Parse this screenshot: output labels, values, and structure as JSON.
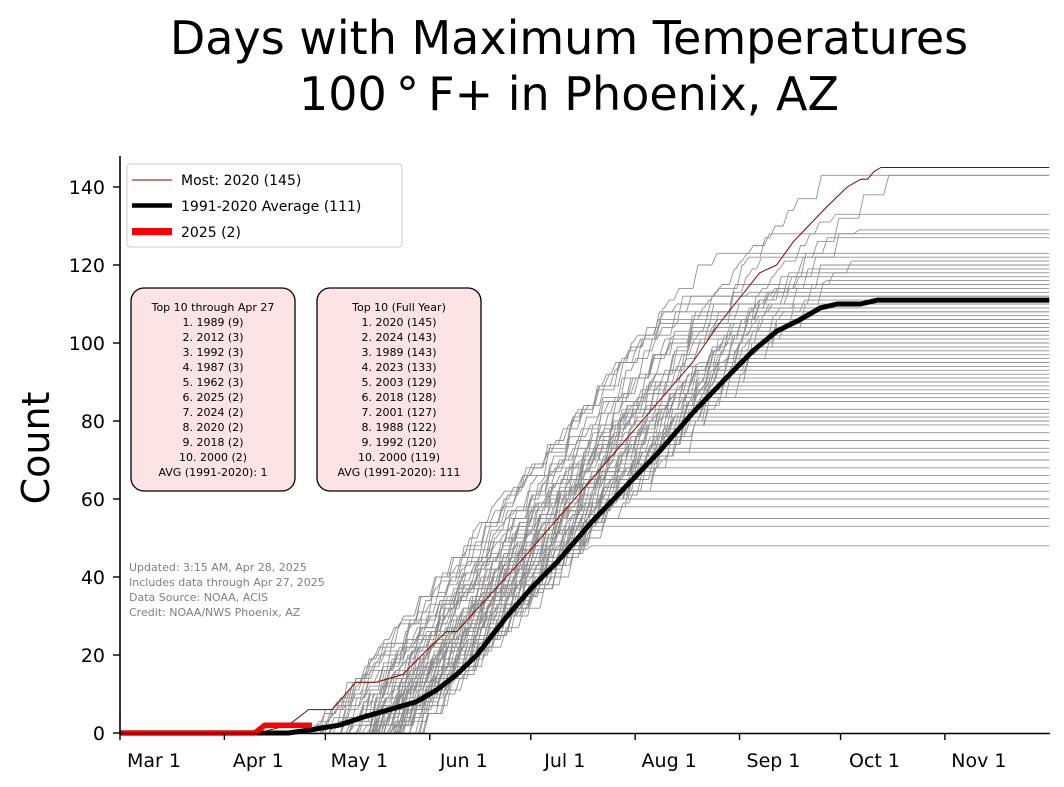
{
  "chart_data": {
    "type": "line",
    "title": [
      "Days with Maximum Temperatures",
      "100 ° F+ in Phoenix, AZ"
    ],
    "xlabel": "",
    "ylabel": "Count",
    "x_axis": {
      "unit": "days since Mar 1",
      "range": [
        0,
        276
      ],
      "ticks": [
        {
          "day": 0,
          "label": "Mar 1"
        },
        {
          "day": 31,
          "label": "Apr 1"
        },
        {
          "day": 61,
          "label": "May 1"
        },
        {
          "day": 92,
          "label": "Jun 1"
        },
        {
          "day": 122,
          "label": "Jul 1"
        },
        {
          "day": 153,
          "label": "Aug 1"
        },
        {
          "day": 184,
          "label": "Sep 1"
        },
        {
          "day": 214,
          "label": "Oct 1"
        },
        {
          "day": 245,
          "label": "Nov 1"
        }
      ]
    },
    "y_axis": {
      "range": [
        0,
        148
      ],
      "ticks": [
        0,
        20,
        40,
        60,
        80,
        100,
        120,
        140
      ]
    },
    "grid": false,
    "legend": {
      "placement": "top-left",
      "entries": [
        {
          "label": "Most: 2020 (145)",
          "color": "#8b0000",
          "style": "thin"
        },
        {
          "label": "1991-2020 Average (111)",
          "color": "#000000",
          "style": "thick"
        },
        {
          "label": "2025 (2)",
          "color": "#ff0000",
          "style": "thick"
        }
      ]
    },
    "highlight_series": {
      "most": {
        "name": "2020",
        "color": "#8b0000",
        "final": 145,
        "points": [
          [
            0,
            0
          ],
          [
            41,
            0
          ],
          [
            50,
            2
          ],
          [
            56,
            6
          ],
          [
            63,
            6
          ],
          [
            70,
            13
          ],
          [
            76,
            13
          ],
          [
            84,
            15
          ],
          [
            92,
            22
          ],
          [
            97,
            26
          ],
          [
            100,
            26
          ],
          [
            120,
            45
          ],
          [
            125,
            50
          ],
          [
            140,
            65
          ],
          [
            170,
            95
          ],
          [
            178,
            105
          ],
          [
            190,
            118
          ],
          [
            195,
            120
          ],
          [
            200,
            126
          ],
          [
            210,
            135
          ],
          [
            216,
            140
          ],
          [
            220,
            142
          ],
          [
            222,
            142
          ],
          [
            224,
            144
          ],
          [
            226,
            145
          ],
          [
            276,
            145
          ]
        ]
      },
      "average": {
        "name": "1991-2020 Average",
        "color": "#000000",
        "final": 111,
        "points": [
          [
            0,
            0
          ],
          [
            50,
            0
          ],
          [
            58,
            1
          ],
          [
            65,
            2
          ],
          [
            72,
            4
          ],
          [
            80,
            6
          ],
          [
            88,
            8
          ],
          [
            94,
            11
          ],
          [
            100,
            15
          ],
          [
            106,
            20
          ],
          [
            115,
            30
          ],
          [
            122,
            37
          ],
          [
            130,
            44
          ],
          [
            140,
            54
          ],
          [
            150,
            63
          ],
          [
            160,
            72
          ],
          [
            170,
            82
          ],
          [
            180,
            91
          ],
          [
            188,
            98
          ],
          [
            195,
            103
          ],
          [
            202,
            106
          ],
          [
            208,
            109
          ],
          [
            213,
            110
          ],
          [
            220,
            110
          ],
          [
            225,
            111
          ],
          [
            276,
            111
          ]
        ]
      },
      "current": {
        "name": "2025",
        "color": "#ff0000",
        "final": 2,
        "points": [
          [
            0,
            0
          ],
          [
            40,
            0
          ],
          [
            43,
            2
          ],
          [
            57,
            2
          ],
          [
            57,
            2
          ]
        ]
      }
    },
    "background_series_finals": [
      48,
      53,
      55,
      58,
      60,
      62,
      64,
      66,
      68,
      70,
      72,
      73,
      75,
      77,
      79,
      80,
      81,
      82,
      83,
      85,
      86,
      87,
      88,
      89,
      90,
      91,
      92,
      93,
      94,
      95,
      96,
      97,
      98,
      99,
      100,
      100,
      101,
      102,
      103,
      103,
      104,
      105,
      106,
      106,
      107,
      108,
      108,
      109,
      110,
      110,
      111,
      112,
      112,
      113,
      114,
      115,
      116,
      117,
      118,
      119,
      120,
      121,
      122,
      123,
      127,
      128,
      129,
      133,
      143,
      143
    ],
    "annotations": {
      "box_through_date": {
        "title": "Top 10 through Apr 27",
        "lines": [
          "1. 1989 (9)",
          "2. 2012 (3)",
          "3. 1992 (3)",
          "4. 1987 (3)",
          "5. 1962 (3)",
          "6. 2025 (2)",
          "7. 2024 (2)",
          "8. 2020 (2)",
          "9. 2018 (2)",
          "10. 2000 (2)"
        ],
        "avg": "AVG (1991-2020): 1"
      },
      "box_full_year": {
        "title": "Top 10 (Full Year)",
        "lines": [
          "1. 2020 (145)",
          "2. 2024 (143)",
          "3. 1989 (143)",
          "4. 2023 (133)",
          "5. 2003 (129)",
          "6. 2018 (128)",
          "7. 2001 (127)",
          "8. 1988 (122)",
          "9. 1992 (120)",
          "10. 2000 (119)"
        ],
        "avg": "AVG (1991-2020): 111"
      },
      "notes": [
        "Updated: 3:15 AM, Apr 28, 2025",
        "Includes data through Apr 27, 2025",
        "Data Source: NOAA, ACIS",
        "Credit: NOAA/NWS Phoenix, AZ"
      ]
    }
  },
  "colors": {
    "background_series": "#8c8c8c",
    "box_fill": "#fde4e4",
    "box_border": "#000000",
    "note": "#808080"
  }
}
